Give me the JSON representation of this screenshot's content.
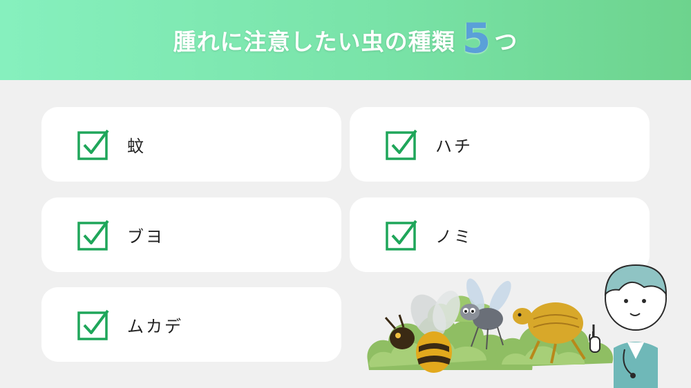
{
  "header": {
    "title_prefix": "腫れに注意したい虫の種類",
    "title_number": "5",
    "title_suffix": "つ"
  },
  "items": [
    {
      "label": "蚊"
    },
    {
      "label": "ハチ"
    },
    {
      "label": "ブヨ"
    },
    {
      "label": "ノミ"
    },
    {
      "label": "ムカデ"
    }
  ],
  "colors": {
    "header_start": "#86f0be",
    "header_end": "#6dd38d",
    "check": "#1fa65a",
    "number": "#5aa0d8",
    "background": "#f0f0f0"
  },
  "icons": [
    "checkbox-check-icon"
  ]
}
